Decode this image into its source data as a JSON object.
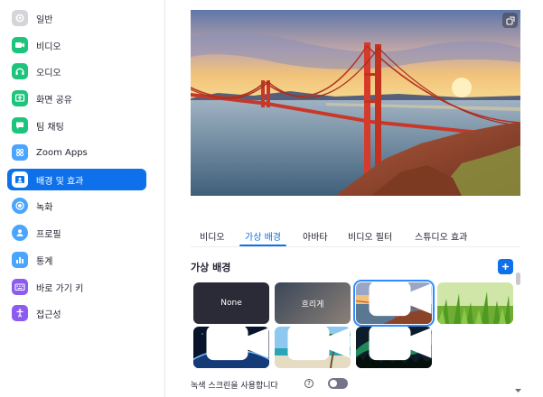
{
  "sidebar": {
    "items": [
      {
        "label": "일반",
        "icon": "gear-icon",
        "color": "#d5d5d9",
        "active": false
      },
      {
        "label": "비디오",
        "icon": "video-camera-icon",
        "color": "#1dc57c",
        "active": false
      },
      {
        "label": "오디오",
        "icon": "headphones-icon",
        "color": "#1dc57c",
        "active": false
      },
      {
        "label": "화면 공유",
        "icon": "screen-share-icon",
        "color": "#1dc57c",
        "active": false
      },
      {
        "label": "팀 채팅",
        "icon": "chat-bubble-icon",
        "color": "#1dc57c",
        "active": false
      },
      {
        "label": "Zoom Apps",
        "icon": "apps-icon",
        "color": "#4aa5ff",
        "active": false
      },
      {
        "label": "배경 및 효과",
        "icon": "background-portrait-icon",
        "color": "#ffffff",
        "active": true
      },
      {
        "label": "녹화",
        "icon": "record-icon",
        "color": "#4aa5ff",
        "active": false
      },
      {
        "label": "프로필",
        "icon": "profile-icon",
        "color": "#4aa5ff",
        "active": false
      },
      {
        "label": "통계",
        "icon": "bar-chart-icon",
        "color": "#4aa5ff",
        "active": false
      },
      {
        "label": "바로 가기 키",
        "icon": "keyboard-icon",
        "color": "#8c5cf0",
        "active": false
      },
      {
        "label": "접근성",
        "icon": "accessibility-icon",
        "color": "#8c5cf0",
        "active": false
      }
    ]
  },
  "tabs": [
    {
      "label": "비디오",
      "active": false
    },
    {
      "label": "가상 배경",
      "active": true
    },
    {
      "label": "아바타",
      "active": false
    },
    {
      "label": "비디오 필터",
      "active": false
    },
    {
      "label": "스튜디오 효과",
      "active": false
    }
  ],
  "section": {
    "title": "가상 배경"
  },
  "backgrounds": [
    {
      "label": "None",
      "kind": "none",
      "selected": false
    },
    {
      "label": "흐리게",
      "kind": "blur",
      "selected": false
    },
    {
      "label": "",
      "kind": "golden-gate-bridge",
      "selected": true
    },
    {
      "label": "",
      "kind": "grass",
      "selected": false
    },
    {
      "label": "",
      "kind": "earth-from-space",
      "selected": false
    },
    {
      "label": "",
      "kind": "beach-palm",
      "selected": false
    },
    {
      "label": "",
      "kind": "aurora",
      "selected": false
    }
  ],
  "greenscreen": {
    "label": "녹색 스크린을 사용합니다",
    "help": "?",
    "enabled": false
  },
  "colors": {
    "accent": "#0e71eb"
  }
}
